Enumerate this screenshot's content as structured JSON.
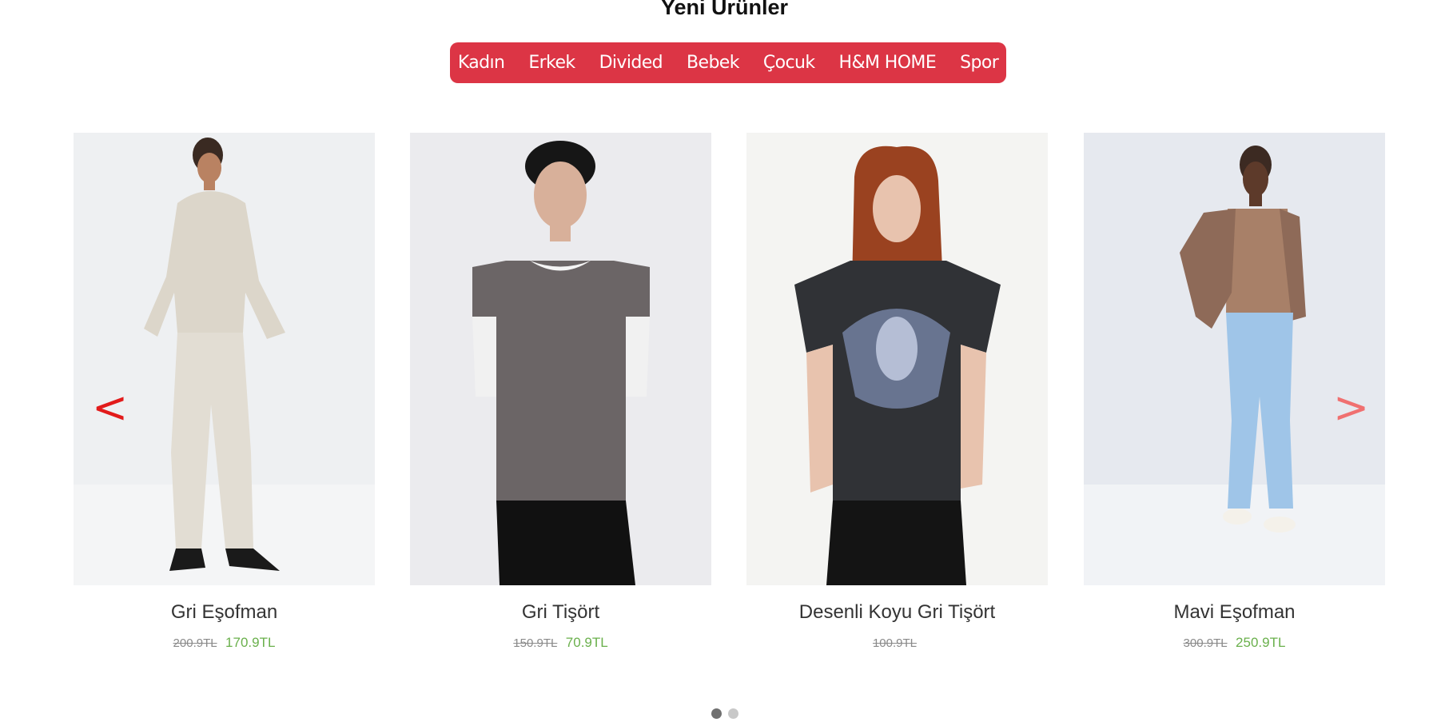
{
  "section": {
    "title": "Yeni Ürünler"
  },
  "categories": [
    "Kadın",
    "Erkek",
    "Divided",
    "Bebek",
    "Çocuk",
    "H&M HOME",
    "Spor"
  ],
  "colors": {
    "accent": "#dc3545",
    "sale_price": "#6ab04c",
    "old_price": "#8a8a8a",
    "prev_arrow": "#e21b1b",
    "next_arrow": "#f07070"
  },
  "carousel": {
    "prev_label": "<",
    "next_label": ">",
    "active_dot": 0,
    "dot_count": 2
  },
  "products": [
    {
      "name": "Gri Eşofman",
      "old_price": "200.9TL",
      "price": "170.9TL"
    },
    {
      "name": "Gri Tişört",
      "old_price": "150.9TL",
      "price": "70.9TL"
    },
    {
      "name": "Desenli Koyu Gri Tişört",
      "old_price": "100.9TL",
      "price": ""
    },
    {
      "name": "Mavi Eşofman",
      "old_price": "300.9TL",
      "price": "250.9TL"
    }
  ]
}
